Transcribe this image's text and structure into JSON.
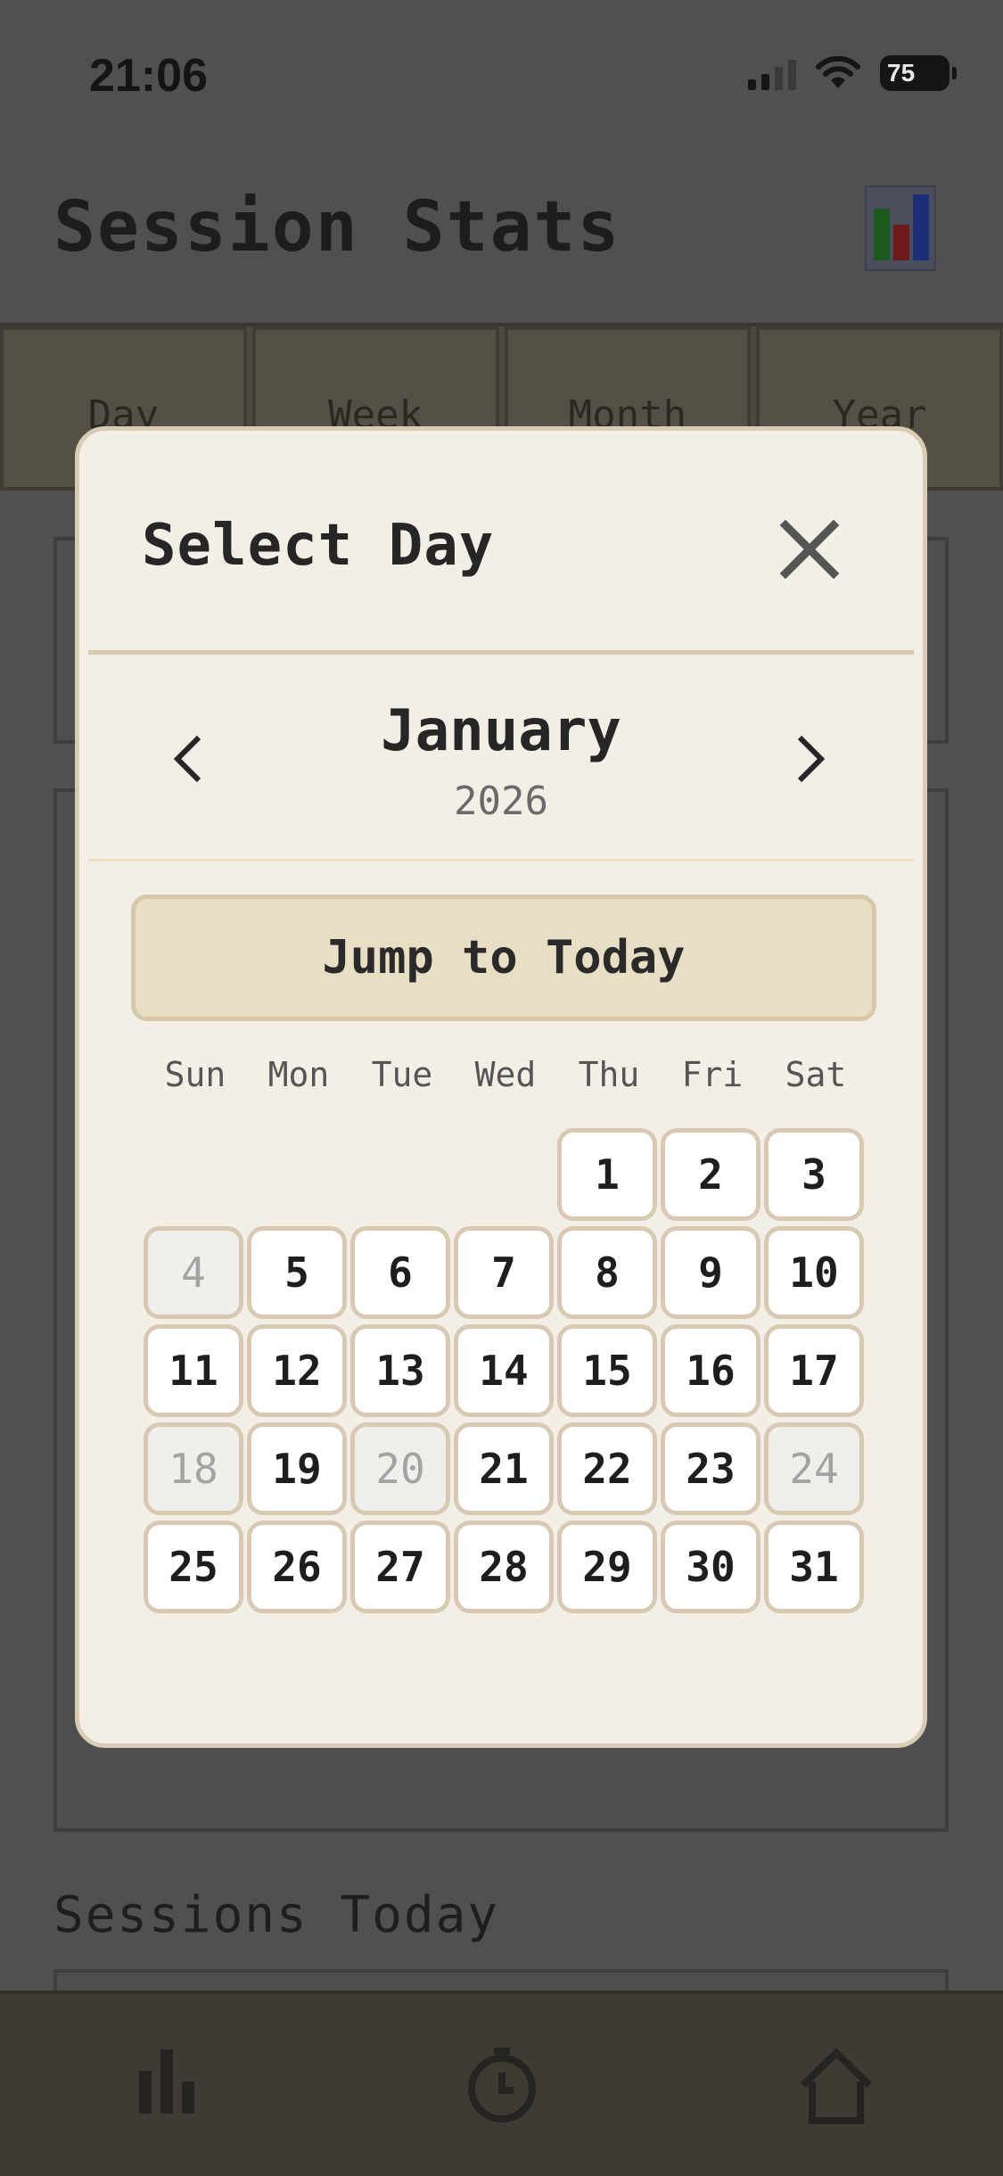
{
  "status_bar": {
    "time": "21:06",
    "battery": "75"
  },
  "header": {
    "title": "Session Stats",
    "icon": "bar-chart-icon"
  },
  "tabs": [
    "Day",
    "Week",
    "Month",
    "Year"
  ],
  "sections": {
    "sessions_title": "Sessions Today"
  },
  "bottom_nav": {
    "icons": [
      "stats-icon",
      "timer-icon",
      "home-icon"
    ]
  },
  "modal": {
    "title": "Select Day",
    "month": "January",
    "year": "2026",
    "jump_label": "Jump to Today",
    "weekdays": [
      "Sun",
      "Mon",
      "Tue",
      "Wed",
      "Thu",
      "Fri",
      "Sat"
    ],
    "first_weekday_index": 4,
    "days": [
      {
        "d": "1",
        "disabled": false
      },
      {
        "d": "2",
        "disabled": false
      },
      {
        "d": "3",
        "disabled": false
      },
      {
        "d": "4",
        "disabled": true
      },
      {
        "d": "5",
        "disabled": false
      },
      {
        "d": "6",
        "disabled": false
      },
      {
        "d": "7",
        "disabled": false
      },
      {
        "d": "8",
        "disabled": false
      },
      {
        "d": "9",
        "disabled": false
      },
      {
        "d": "10",
        "disabled": false
      },
      {
        "d": "11",
        "disabled": false
      },
      {
        "d": "12",
        "disabled": false
      },
      {
        "d": "13",
        "disabled": false
      },
      {
        "d": "14",
        "disabled": false
      },
      {
        "d": "15",
        "disabled": false
      },
      {
        "d": "16",
        "disabled": false
      },
      {
        "d": "17",
        "disabled": false
      },
      {
        "d": "18",
        "disabled": true
      },
      {
        "d": "19",
        "disabled": false
      },
      {
        "d": "20",
        "disabled": true
      },
      {
        "d": "21",
        "disabled": false
      },
      {
        "d": "22",
        "disabled": false
      },
      {
        "d": "23",
        "disabled": false
      },
      {
        "d": "24",
        "disabled": true
      },
      {
        "d": "25",
        "disabled": false
      },
      {
        "d": "26",
        "disabled": false
      },
      {
        "d": "27",
        "disabled": false
      },
      {
        "d": "28",
        "disabled": false
      },
      {
        "d": "29",
        "disabled": false
      },
      {
        "d": "30",
        "disabled": false
      },
      {
        "d": "31",
        "disabled": false
      }
    ]
  },
  "colors": {
    "modal_bg": "#f3efe6",
    "border": "#d8cab2",
    "jump_bg": "#e8dec3",
    "overlay": "#505052"
  }
}
